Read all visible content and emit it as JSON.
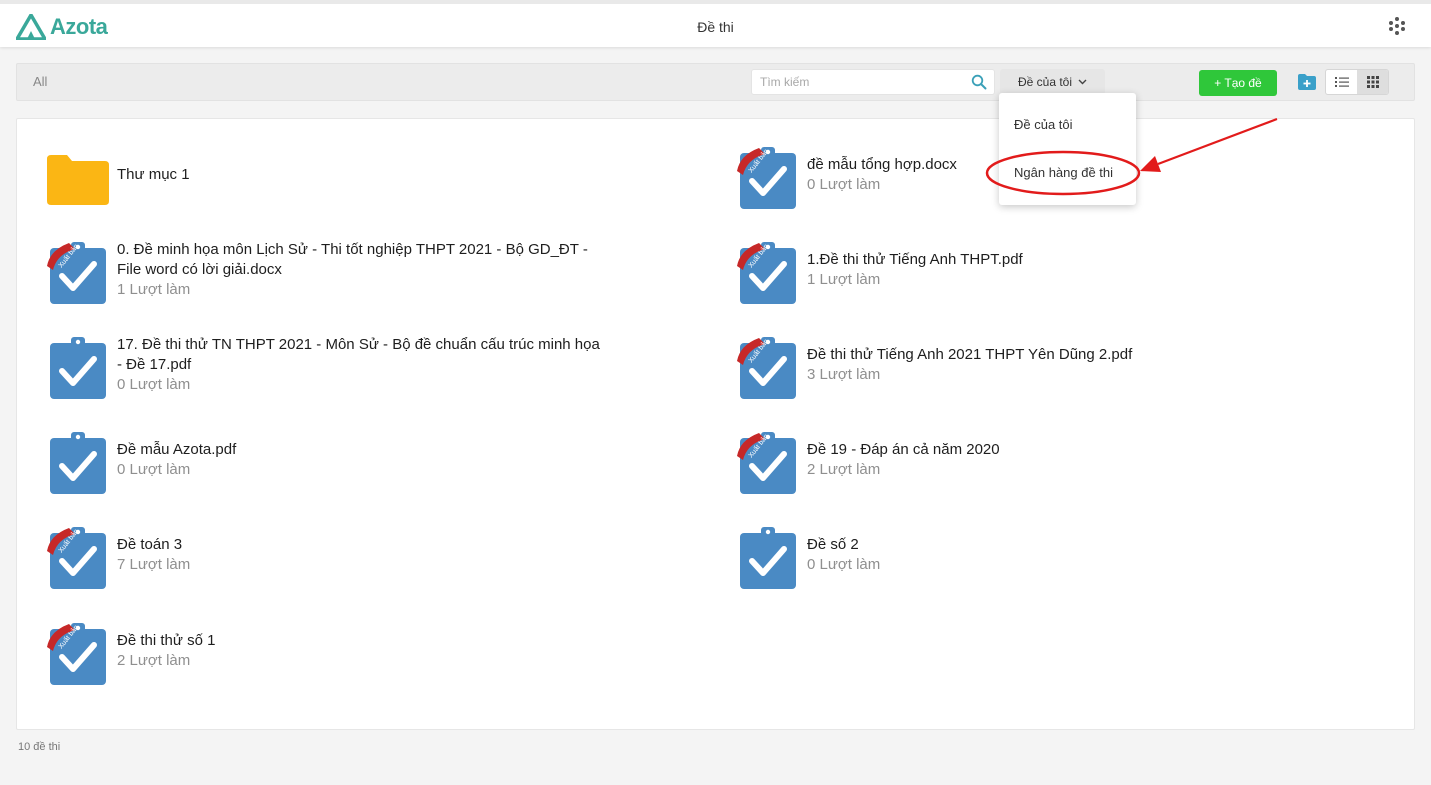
{
  "header": {
    "logo_text": "Azota",
    "title": "Đề thi"
  },
  "toolbar": {
    "all_label": "All",
    "search_placeholder": "Tìm kiếm",
    "filter_label": "Đề của tôi",
    "create_label": "+ Tạo đề"
  },
  "dropdown": {
    "items": [
      "Đề của tôi",
      "Ngân hàng đề thi"
    ],
    "highlighted": "Ngân hàng đề thi"
  },
  "badge_text": "Xuất bản",
  "items": [
    {
      "kind": "folder",
      "name": "Thư mục 1"
    },
    {
      "kind": "exam",
      "name": "đề mẫu tổng hợp.docx",
      "sub": "0 Lượt làm",
      "published": true
    },
    {
      "kind": "exam",
      "name": "0. Đề minh họa môn Lịch Sử - Thi tốt nghiệp THPT 2021 - Bộ GD_ĐT - File word có lời giải.docx",
      "sub": "1 Lượt làm",
      "published": true
    },
    {
      "kind": "exam",
      "name": "1.Đề thi thử Tiếng Anh THPT.pdf",
      "sub": "1 Lượt làm",
      "published": true
    },
    {
      "kind": "exam",
      "name": "17. Đề thi thử TN THPT 2021 - Môn Sử - Bộ đề chuẩn cấu trúc minh họa - Đề 17.pdf",
      "sub": "0 Lượt làm",
      "published": false
    },
    {
      "kind": "exam",
      "name": "Đề thi thử Tiếng Anh 2021 THPT Yên Dũng 2.pdf",
      "sub": "3 Lượt làm",
      "published": true
    },
    {
      "kind": "exam",
      "name": "Đề mẫu Azota.pdf",
      "sub": "0 Lượt làm",
      "published": false
    },
    {
      "kind": "exam",
      "name": "Đề 19 - Đáp án cả năm 2020",
      "sub": "2 Lượt làm",
      "published": true
    },
    {
      "kind": "exam",
      "name": "Đề toán 3",
      "sub": "7 Lượt làm",
      "published": true
    },
    {
      "kind": "exam",
      "name": "Đề số 2",
      "sub": "0 Lượt làm",
      "published": false
    },
    {
      "kind": "exam",
      "name": "Đề thi thử số 1",
      "sub": "2 Lượt làm",
      "published": true
    }
  ],
  "footer": {
    "count_text": "10 đề thi"
  },
  "colors": {
    "brand": "#3aa89a",
    "create": "#2fc73a",
    "icon_blue": "#4a8ac4",
    "folder": "#fbb614",
    "badge": "#c62828",
    "annotation": "#e21b1b"
  }
}
